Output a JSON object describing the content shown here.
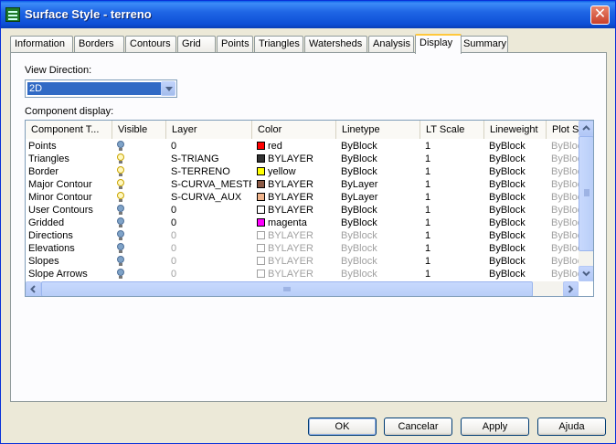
{
  "window": {
    "title": "Surface Style - terreno",
    "close_label": "✕"
  },
  "tabs": [
    "Information",
    "Borders",
    "Contours",
    "Grid",
    "Points",
    "Triangles",
    "Watersheds",
    "Analysis",
    "Display",
    "Summary"
  ],
  "active_tab": "Display",
  "view_direction": {
    "label": "View Direction:",
    "value": "2D"
  },
  "component_display": {
    "label": "Component display:",
    "columns": [
      "Component T...",
      "Visible",
      "Layer",
      "Color",
      "Linetype",
      "LT Scale",
      "Lineweight",
      "Plot S"
    ],
    "rows": [
      {
        "component": "Points",
        "visible": false,
        "layer": "0",
        "swatch": "#FF0000",
        "color": "red",
        "linetype": "ByBlock",
        "lt_scale": "1",
        "lineweight": "ByBlock",
        "plot": "ByBlock",
        "dimmed": false
      },
      {
        "component": "Triangles",
        "visible": true,
        "layer": "S-TRIANG",
        "swatch": "#333333",
        "color": "BYLAYER",
        "linetype": "ByBlock",
        "lt_scale": "1",
        "lineweight": "ByBlock",
        "plot": "ByBlock",
        "dimmed": false
      },
      {
        "component": "Border",
        "visible": true,
        "layer": "S-TERRENO",
        "swatch": "#FFFF00",
        "color": "yellow",
        "linetype": "ByBlock",
        "lt_scale": "1",
        "lineweight": "ByBlock",
        "plot": "ByBlock",
        "dimmed": false
      },
      {
        "component": "Major Contour",
        "visible": true,
        "layer": "S-CURVA_MESTRA",
        "swatch": "#8B5A45",
        "color": "BYLAYER",
        "linetype": "ByLayer",
        "lt_scale": "1",
        "lineweight": "ByBlock",
        "plot": "ByBlock",
        "dimmed": false
      },
      {
        "component": "Minor Contour",
        "visible": true,
        "layer": "S-CURVA_AUX",
        "swatch": "#F0B48C",
        "color": "BYLAYER",
        "linetype": "ByLayer",
        "lt_scale": "1",
        "lineweight": "ByBlock",
        "plot": "ByBlock",
        "dimmed": false
      },
      {
        "component": "User Contours",
        "visible": false,
        "layer": "0",
        "swatch": "#FFFFFF",
        "color": "BYLAYER",
        "linetype": "ByBlock",
        "lt_scale": "1",
        "lineweight": "ByBlock",
        "plot": "ByBlock",
        "dimmed": false
      },
      {
        "component": "Gridded",
        "visible": false,
        "layer": "0",
        "swatch": "#FF00FF",
        "color": "magenta",
        "linetype": "ByBlock",
        "lt_scale": "1",
        "lineweight": "ByBlock",
        "plot": "ByBlock",
        "dimmed": false
      },
      {
        "component": "Directions",
        "visible": false,
        "layer": "0",
        "swatch": "#FFFFFF",
        "color": "BYLAYER",
        "linetype": "ByBlock",
        "lt_scale": "1",
        "lineweight": "ByBlock",
        "plot": "ByBlock",
        "dimmed": true
      },
      {
        "component": "Elevations",
        "visible": false,
        "layer": "0",
        "swatch": "#FFFFFF",
        "color": "BYLAYER",
        "linetype": "ByBlock",
        "lt_scale": "1",
        "lineweight": "ByBlock",
        "plot": "ByBlock",
        "dimmed": true
      },
      {
        "component": "Slopes",
        "visible": false,
        "layer": "0",
        "swatch": "#FFFFFF",
        "color": "BYLAYER",
        "linetype": "ByBlock",
        "lt_scale": "1",
        "lineweight": "ByBlock",
        "plot": "ByBlock",
        "dimmed": true
      },
      {
        "component": "Slope Arrows",
        "visible": false,
        "layer": "0",
        "swatch": "#FFFFFF",
        "color": "BYLAYER",
        "linetype": "ByBlock",
        "lt_scale": "1",
        "lineweight": "ByBlock",
        "plot": "ByBlock",
        "dimmed": true
      }
    ]
  },
  "buttons": {
    "ok": "OK",
    "cancel": "Cancelar",
    "apply": "Apply",
    "help": "Ajuda"
  },
  "icons": {
    "title": "surface-style-icon",
    "bulb_on": "lightbulb-on-icon",
    "bulb_off": "lightbulb-off-icon"
  },
  "colors": {
    "title_bar": "#0A5FE8",
    "selection": "#316AC5",
    "close": "#C9402A"
  }
}
